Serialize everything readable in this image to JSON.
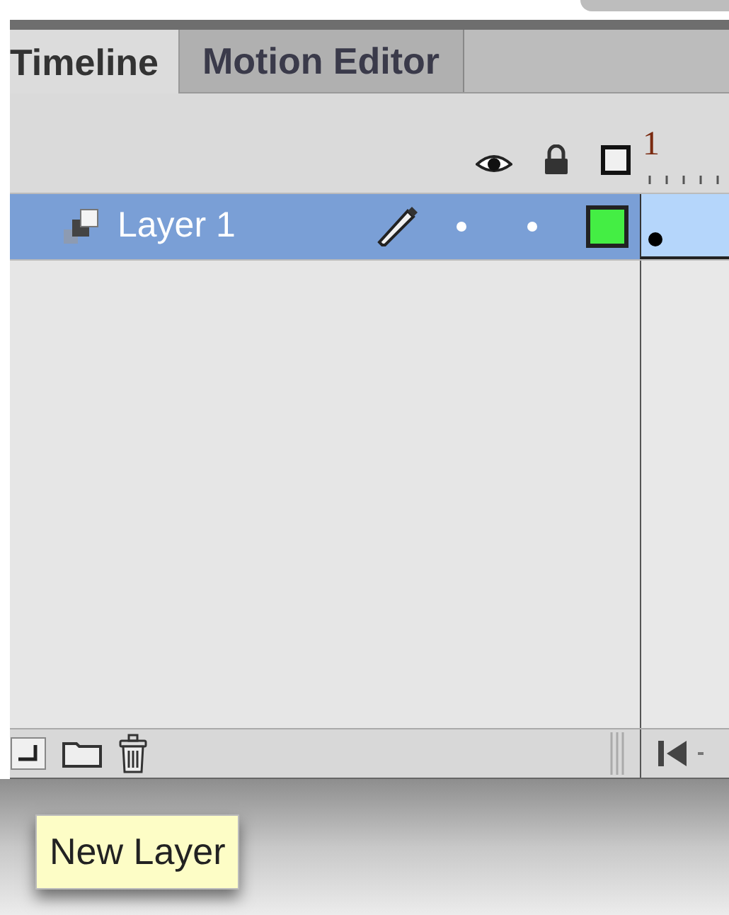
{
  "tabs": [
    {
      "label": "Timeline",
      "selected": true
    },
    {
      "label": "Motion Editor",
      "selected": false
    }
  ],
  "frame_ruler": {
    "first_frame": "1"
  },
  "layers": [
    {
      "name": "Layer 1",
      "selected": true,
      "editing": true,
      "color": "#44ee44"
    }
  ],
  "tooltip": "New Layer"
}
